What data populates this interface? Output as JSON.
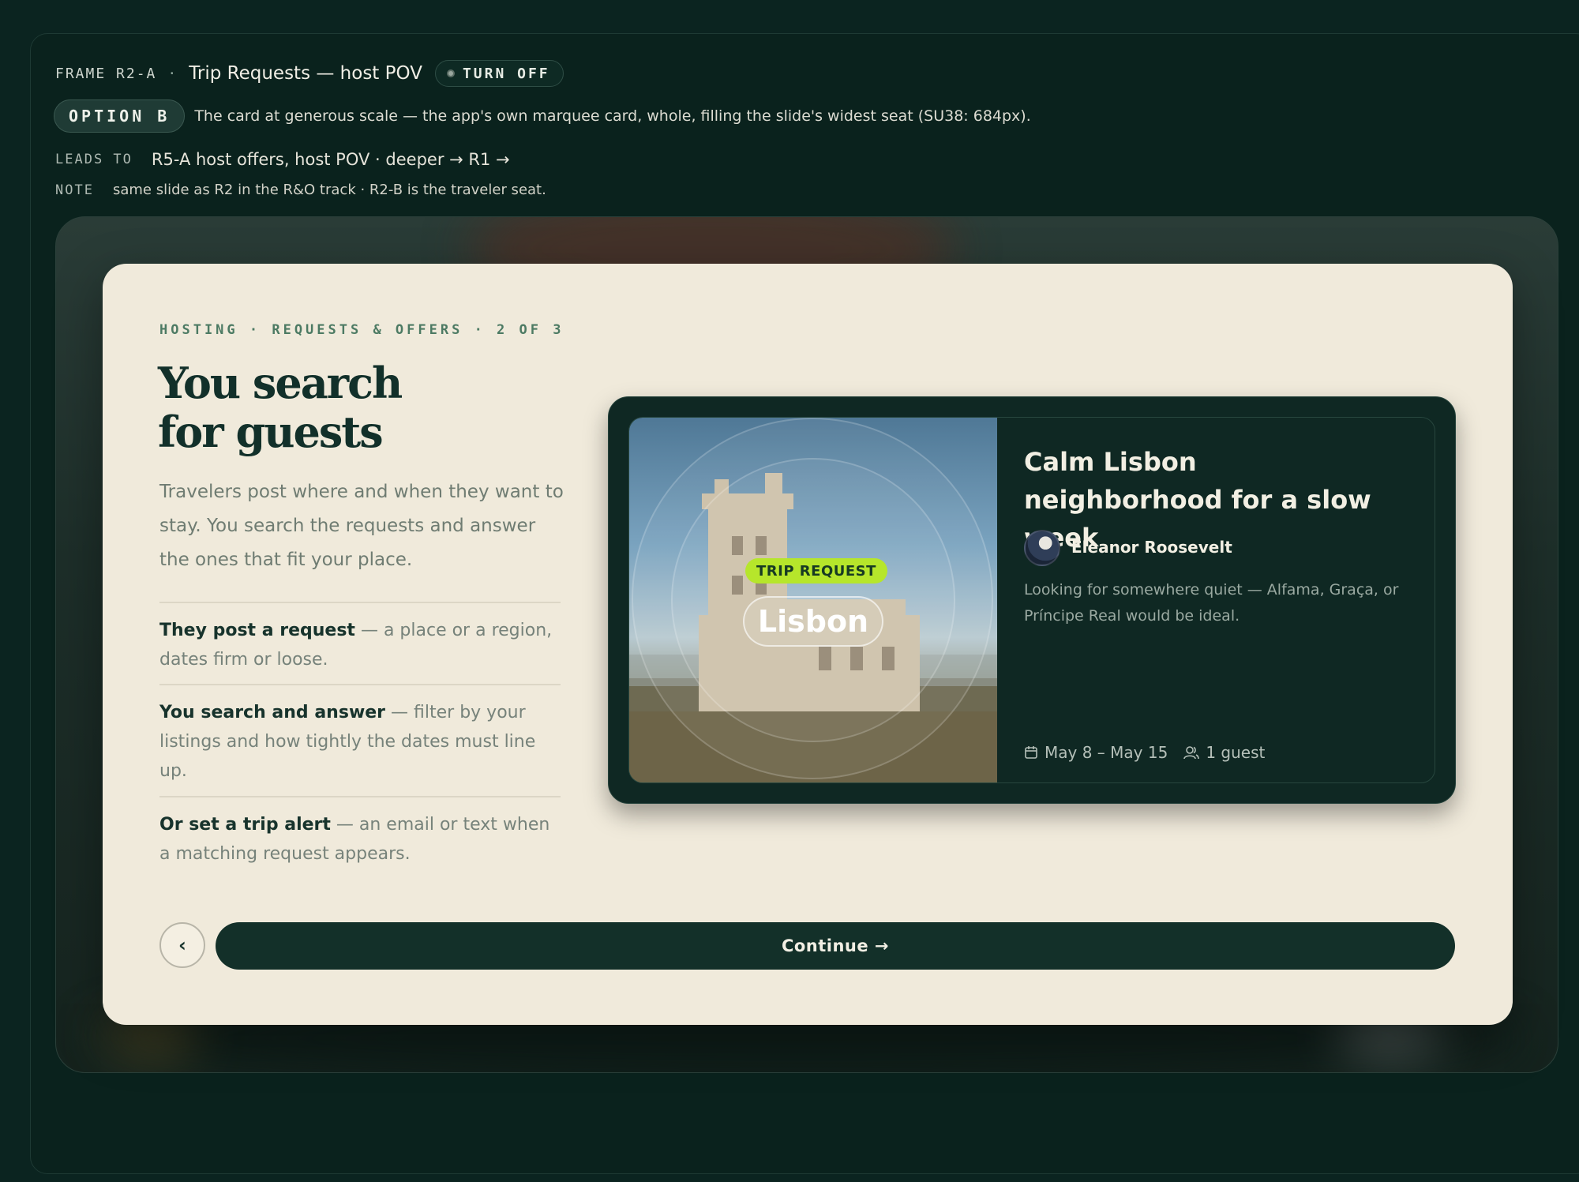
{
  "frame": {
    "id": "FRAME R2-A",
    "separator": "·",
    "title": "Trip Requests — host POV",
    "toggle_label": "TURN OFF"
  },
  "option": {
    "label": "OPTION B",
    "description": "The card at generous scale — the app's own marquee card, whole, filling the slide's widest seat (SU38: 684px)."
  },
  "leads_to": {
    "key": "LEADS TO",
    "value": "R5-A host offers, host POV · deeper → R1 →"
  },
  "note": {
    "key": "NOTE",
    "value": "same slide as R2 in the R&O track · R2-B is the traveler seat."
  },
  "slide": {
    "breadcrumb": "HOSTING · REQUESTS & OFFERS · 2 OF 3",
    "headline_line1": "You search",
    "headline_line2": "for guests",
    "lede": "Travelers post where and when they want to stay. You search the requests and answer the ones that fit your place.",
    "bullets": [
      {
        "strong": "They post a request",
        "rest": " — a place or a region, dates firm or loose."
      },
      {
        "strong": "You search and answer",
        "rest": " — filter by your listings and how tightly the dates must line up."
      },
      {
        "strong": "Or set a trip alert",
        "rest": " — an email or text when a matching request appears."
      }
    ],
    "back_icon": "chevron-left-icon",
    "back_glyph": "‹",
    "continue_label": "Continue →"
  },
  "trip_card": {
    "tag": "TRIP REQUEST",
    "city": "Lisbon",
    "title": "Calm Lisbon neighborhood for a slow week",
    "host_name": "Eleanor Roosevelt",
    "description": "Looking for somewhere quiet — Alfama, Graça, or Príncipe Real would be ideal.",
    "dates": "May 8 – May 15",
    "guests": "1 guest"
  },
  "colors": {
    "page_bg": "#0b2420",
    "card_bg": "#f0eadb",
    "accent_lime": "#b6e62b",
    "ink": "#12302a"
  }
}
